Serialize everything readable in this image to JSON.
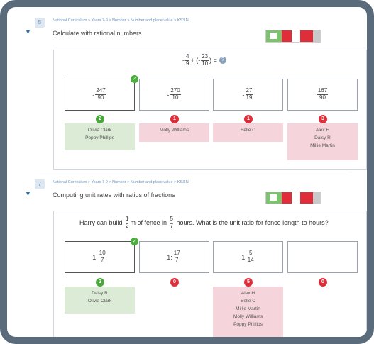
{
  "questions": [
    {
      "number": "5",
      "breadcrumb": "National Curriculum > Years 7-9 > Number > Number and place value > KS3.N",
      "title": "Calculate with rational numbers",
      "prompt_expr": {
        "sign1": "-",
        "f1_num": "4",
        "f1_den": "9",
        "mid": "+ (-",
        "f2_num": "23",
        "f2_den": "10",
        "end": ") =",
        "help": "?"
      },
      "answers": [
        {
          "sign": "-",
          "num": "247",
          "den": "90",
          "count": "2",
          "students": [
            "Olivia Clark",
            "Poppy Phillips"
          ],
          "status": "correct"
        },
        {
          "sign": "-",
          "num": "270",
          "den": "10",
          "count": "1",
          "students": [
            "Molly Williams"
          ],
          "status": "wrong"
        },
        {
          "sign": "-",
          "num": "27",
          "den": "19",
          "count": "1",
          "students": [
            "Belle C"
          ],
          "status": "wrong"
        },
        {
          "sign": "",
          "num": "167",
          "den": "90",
          "count": "3",
          "students": [
            "Alex H",
            "Daisy R",
            "Millie Martin"
          ],
          "status": "wrong"
        }
      ]
    },
    {
      "number": "7",
      "breadcrumb": "National Curriculum > Years 7-9 > Number > Number and place value > KS3.N",
      "title": "Computing unit rates with ratios of fractions",
      "prompt": {
        "a": "Harry can build",
        "f1_num": "1",
        "f1_den": "2",
        "b": "m of fence in",
        "f2_num": "5",
        "f2_den": "7",
        "c": "hours. What is the unit ratio for fence length to hours?"
      },
      "answers": [
        {
          "prefix": "1:",
          "num": "10",
          "den": "7",
          "count": "2",
          "students": [
            "Daisy R",
            "Olivia Clark"
          ],
          "status": "correct"
        },
        {
          "prefix": "1:",
          "num": "17",
          "den": "7",
          "count": "0",
          "students": [],
          "status": "wrong"
        },
        {
          "prefix": "1:",
          "num": "5",
          "den": "14",
          "count": "5",
          "students": [
            "Alex H",
            "Belle C",
            "Millie Martin",
            "Molly Williams",
            "Poppy Phillips"
          ],
          "status": "wrong"
        },
        {
          "prefix": "",
          "num": "",
          "den": "",
          "count": "0",
          "students": [],
          "status": "wrong"
        }
      ]
    }
  ],
  "icons": {
    "collapse": "chevron-down-icon",
    "correct": "check-icon"
  },
  "colors": {
    "correct": "#4aa83b",
    "wrong": "#e02d3a",
    "correct_bg": "#dcebd6",
    "wrong_bg": "#f5d5db"
  }
}
